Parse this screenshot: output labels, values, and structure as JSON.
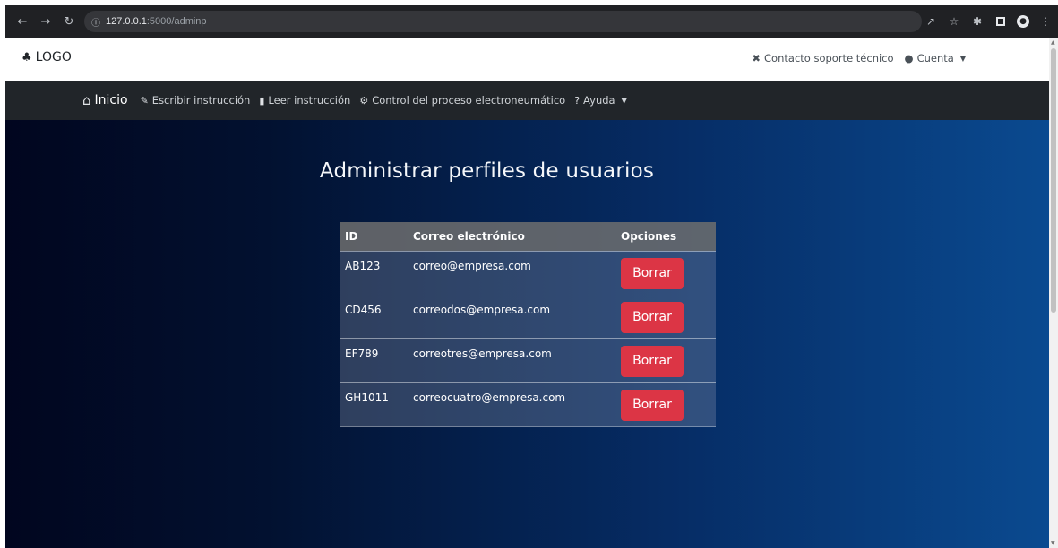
{
  "browser": {
    "url_host": "127.0.0.1",
    "url_path": ":5000/adminp",
    "back_icon": "arrow-left-icon",
    "forward_icon": "arrow-right-icon",
    "reload_icon": "reload-icon"
  },
  "header": {
    "logo_text": "LOGO",
    "support_label": "Contacto soporte técnico",
    "account_label": "Cuenta"
  },
  "nav": {
    "home": "Inicio",
    "items": [
      {
        "label": "Escribir instrucción"
      },
      {
        "label": "Leer instrucción"
      },
      {
        "label": "Control del proceso electroneumático"
      },
      {
        "label": "Ayuda"
      }
    ]
  },
  "main": {
    "title": "Administrar perfiles de usuarios",
    "table": {
      "headers": [
        "ID",
        "Correo electrónico",
        "Opciones"
      ],
      "rows": [
        {
          "id": "AB123",
          "email": "correo@empresa.com",
          "action": "Borrar"
        },
        {
          "id": "CD456",
          "email": "correodos@empresa.com",
          "action": "Borrar"
        },
        {
          "id": "EF789",
          "email": "correotres@empresa.com",
          "action": "Borrar"
        },
        {
          "id": "GH1011",
          "email": "correocuatro@empresa.com",
          "action": "Borrar"
        }
      ]
    }
  },
  "colors": {
    "navbar_bg": "#212529",
    "delete_button": "#dc3545",
    "gradient_start": "#01061f",
    "gradient_end": "#0a4a90"
  }
}
